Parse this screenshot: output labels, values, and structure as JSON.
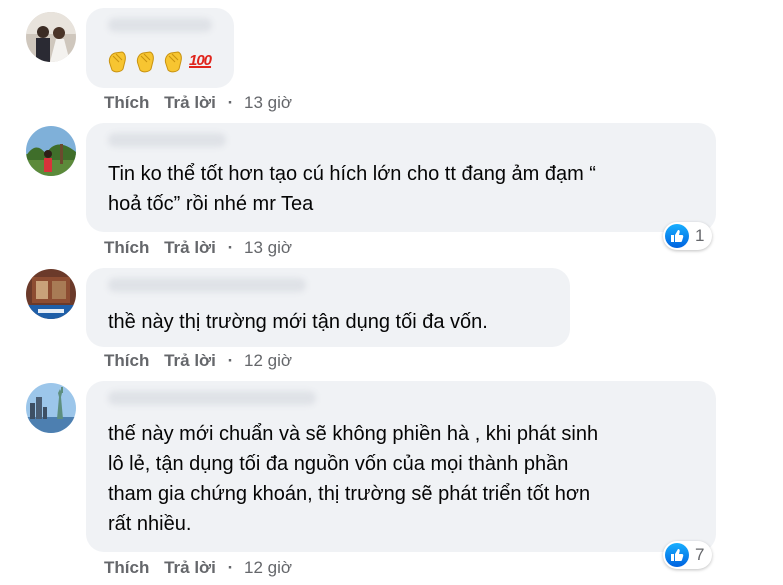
{
  "comments": [
    {
      "author": "",
      "text": "",
      "emoji_names": [
        "clapping-hands",
        "clapping-hands",
        "clapping-hands",
        "hundred-points"
      ],
      "hundred_text": "100",
      "like_label": "Thích",
      "reply_label": "Trả lời",
      "separator": "·",
      "time": "13 giờ",
      "reaction_count": null
    },
    {
      "author": "",
      "text": "Tin ko thể tốt hơn tạo cú hích lớn cho tt đang ảm đạm “\nhoả tốc” rồi nhé mr Tea",
      "like_label": "Thích",
      "reply_label": "Trả lời",
      "separator": "·",
      "time": "13 giờ",
      "reaction_icon": "like-icon",
      "reaction_count": "1"
    },
    {
      "author": "",
      "text": "thề này thị trường mới tận dụng tối đa vốn.",
      "like_label": "Thích",
      "reply_label": "Trả lời",
      "separator": "·",
      "time": "12 giờ",
      "reaction_count": null
    },
    {
      "author": "",
      "text": "thế này mới chuẩn và sẽ không phiền hà , khi phát sinh\nlô lẻ, tận dụng tối đa nguồn vốn của mọi thành phần\ntham gia chứng khoán, thị trường sẽ phát triển tốt hơn\nrất nhiều.",
      "like_label": "Thích",
      "reply_label": "Trả lời",
      "separator": "·",
      "time": "12 giờ",
      "reaction_icon": "like-icon",
      "reaction_count": "7"
    }
  ],
  "colors": {
    "bubble": "#f0f2f5",
    "meta_text": "#65676b",
    "like_blue": "#1877f2",
    "body_text": "#050505"
  }
}
